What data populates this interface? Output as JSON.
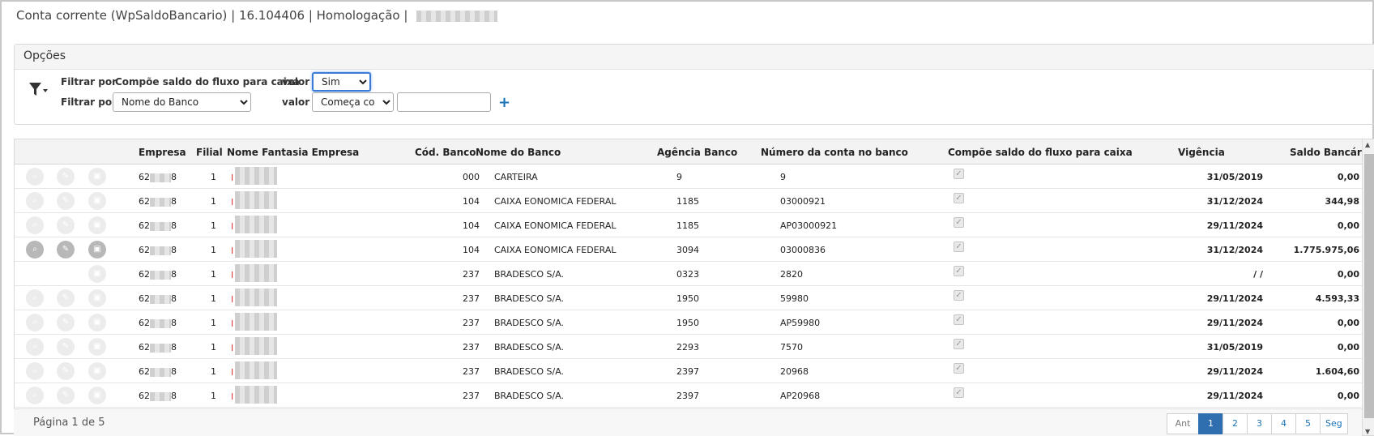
{
  "window": {
    "title": "Conta corrente (WpSaldoBancario) | 16.104406 | Homologação |"
  },
  "options": {
    "header": "Opções",
    "filter1": {
      "label": "Filtrar por",
      "field": "Compõe saldo do fluxo para caixa",
      "value_label": "valor",
      "value": "Sim"
    },
    "filter2": {
      "label": "Filtrar por",
      "field": "Nome do Banco",
      "value_label": "valor",
      "operator": "Começa com",
      "input_value": ""
    }
  },
  "columns": [
    "Empresa",
    "Filial",
    "Nome Fantasia Empresa",
    "Cód. Banco",
    "Nome do Banco",
    "Agência Banco",
    "Número da conta no banco",
    "Compõe saldo do fluxo para caixa",
    "Vigência",
    "Saldo Bancária"
  ],
  "rows": [
    {
      "empresa_a": "62",
      "empresa_b": "8",
      "filial": "1",
      "fantasia": "I",
      "cod": "000",
      "banco": "CARTEIRA",
      "agencia": "9",
      "conta": "9",
      "vigencia": "31/05/2019",
      "saldo": "0,00",
      "buttons": 3,
      "dark": false
    },
    {
      "empresa_a": "62",
      "empresa_b": "8",
      "filial": "1",
      "fantasia": "I",
      "cod": "104",
      "banco": "CAIXA EONOMICA FEDERAL",
      "agencia": "1185",
      "conta": "03000921",
      "vigencia": "31/12/2024",
      "saldo": "344,98",
      "buttons": 3,
      "dark": false
    },
    {
      "empresa_a": "62",
      "empresa_b": "8",
      "filial": "1",
      "fantasia": "I",
      "cod": "104",
      "banco": "CAIXA EONOMICA FEDERAL",
      "agencia": "1185",
      "conta": "AP03000921",
      "vigencia": "29/11/2024",
      "saldo": "0,00",
      "buttons": 3,
      "dark": false
    },
    {
      "empresa_a": "62",
      "empresa_b": "8",
      "filial": "1",
      "fantasia": "I",
      "cod": "104",
      "banco": "CAIXA EONOMICA FEDERAL",
      "agencia": "3094",
      "conta": "03000836",
      "vigencia": "31/12/2024",
      "saldo": "1.775.975,06",
      "buttons": 3,
      "dark": true
    },
    {
      "empresa_a": "62",
      "empresa_b": "8",
      "filial": "1",
      "fantasia": "I",
      "cod": "237",
      "banco": "BRADESCO S/A.",
      "agencia": "0323",
      "conta": "2820",
      "vigencia": "/ /",
      "saldo": "0,00",
      "buttons": 1,
      "dark": false
    },
    {
      "empresa_a": "62",
      "empresa_b": "8",
      "filial": "1",
      "fantasia": "I",
      "cod": "237",
      "banco": "BRADESCO S/A.",
      "agencia": "1950",
      "conta": "59980",
      "vigencia": "29/11/2024",
      "saldo": "4.593,33",
      "buttons": 3,
      "dark": false
    },
    {
      "empresa_a": "62",
      "empresa_b": "8",
      "filial": "1",
      "fantasia": "I",
      "cod": "237",
      "banco": "BRADESCO S/A.",
      "agencia": "1950",
      "conta": "AP59980",
      "vigencia": "29/11/2024",
      "saldo": "0,00",
      "buttons": 3,
      "dark": false
    },
    {
      "empresa_a": "62",
      "empresa_b": "8",
      "filial": "1",
      "fantasia": "I",
      "cod": "237",
      "banco": "BRADESCO S/A.",
      "agencia": "2293",
      "conta": "7570",
      "vigencia": "31/05/2019",
      "saldo": "0,00",
      "buttons": 3,
      "dark": false
    },
    {
      "empresa_a": "62",
      "empresa_b": "8",
      "filial": "1",
      "fantasia": "I",
      "cod": "237",
      "banco": "BRADESCO S/A.",
      "agencia": "2397",
      "conta": "20968",
      "vigencia": "29/11/2024",
      "saldo": "1.604,60",
      "buttons": 3,
      "dark": false
    },
    {
      "empresa_a": "62",
      "empresa_b": "8",
      "filial": "1",
      "fantasia": "I",
      "cod": "237",
      "banco": "BRADESCO S/A.",
      "agencia": "2397",
      "conta": "AP20968",
      "vigencia": "29/11/2024",
      "saldo": "0,00",
      "buttons": 3,
      "dark": false
    }
  ],
  "footer": {
    "page_info": "Página 1 de 5",
    "pages": [
      "Ant",
      "1",
      "2",
      "3",
      "4",
      "5",
      "Seg"
    ],
    "active_page": "1"
  }
}
